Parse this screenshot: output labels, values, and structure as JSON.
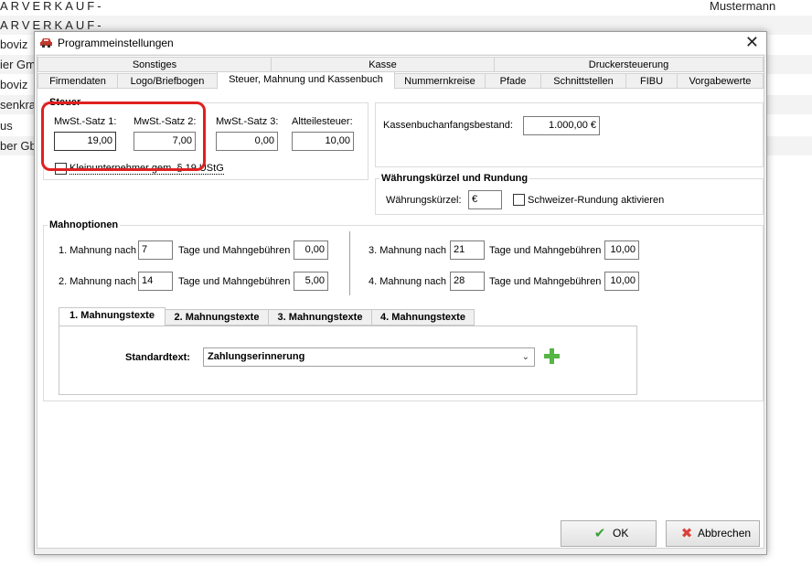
{
  "background": {
    "rows": [
      "ARVERKAUF-",
      "ARVERKAUF-",
      "boviz",
      "ier Gm",
      "boviz",
      "senkran",
      "us",
      "ber Gb"
    ],
    "user_name": "Mustermann"
  },
  "dialog": {
    "title": "Programmeinstellungen",
    "tabs_row1": [
      "Sonstiges",
      "Kasse",
      "Druckersteuerung"
    ],
    "tabs_row2": [
      "Firmendaten",
      "Logo/Briefbogen",
      "Steuer, Mahnung und Kassenbuch",
      "Nummernkreise",
      "Pfade",
      "Schnittstellen",
      "FIBU",
      "Vorgabewerte"
    ],
    "steuer": {
      "title": "Steuer",
      "mwst1_label": "MwSt.-Satz 1:",
      "mwst1_value": "19,00",
      "mwst2_label": "MwSt.-Satz 2:",
      "mwst2_value": "7,00",
      "mwst3_label": "MwSt.-Satz 3:",
      "mwst3_value": "0,00",
      "altteil_label": "Altteilesteuer:",
      "altteil_value": "10,00",
      "klein_label": "Kleinunternehmer gem. § 19 UStG"
    },
    "kassenbuch": {
      "label": "Kassenbuchanfangsbestand:",
      "value": "1.000,00 €"
    },
    "waehrung": {
      "title": "Währungskürzel und Rundung",
      "kuerzel_label": "Währungskürzel:",
      "kuerzel_value": "€",
      "schweizer_label": "Schweizer-Rundung aktivieren"
    },
    "mahnoptionen": {
      "title": "Mahnoptionen",
      "nach_suffix": "Tage und Mahngebühren",
      "items": [
        {
          "label": "1. Mahnung nach",
          "days": "7",
          "fee": "0,00"
        },
        {
          "label": "2. Mahnung nach",
          "days": "14",
          "fee": "5,00"
        },
        {
          "label": "3. Mahnung nach",
          "days": "21",
          "fee": "10,00"
        },
        {
          "label": "4. Mahnung nach",
          "days": "28",
          "fee": "10,00"
        }
      ],
      "text_tabs": [
        "1. Mahnungstexte",
        "2. Mahnungstexte",
        "3. Mahnungstexte",
        "4. Mahnungstexte"
      ],
      "standard_label": "Standardtext:",
      "standard_value": "Zahlungserinnerung"
    },
    "buttons": {
      "ok": "OK",
      "cancel": "Abbrechen"
    }
  }
}
